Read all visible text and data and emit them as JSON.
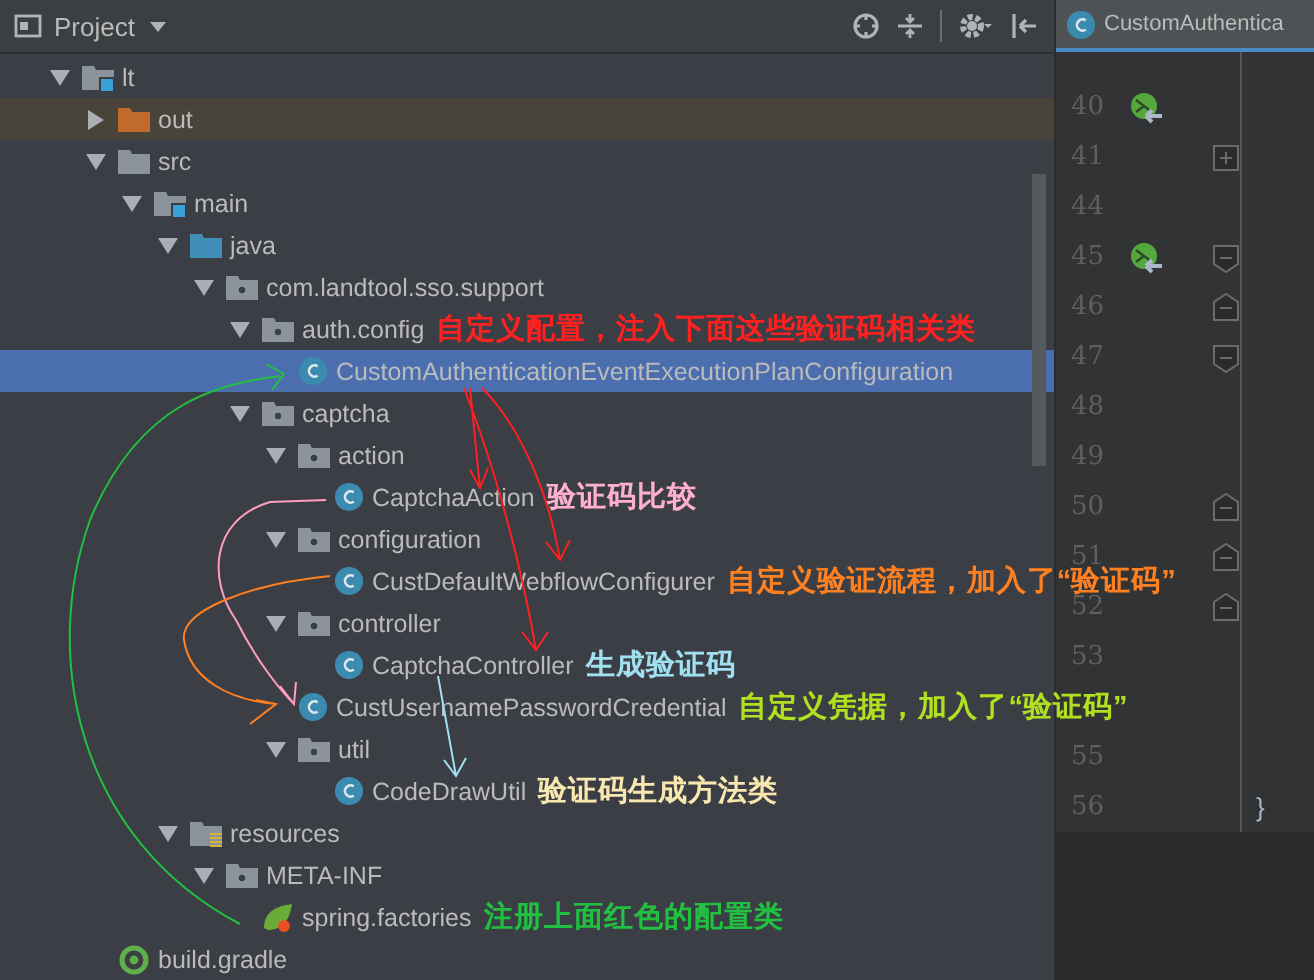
{
  "panel": {
    "title": "Project"
  },
  "tree": [
    {
      "label": "lt",
      "kind": "module",
      "expanded": true,
      "selected": false,
      "children": [
        {
          "label": "out",
          "kind": "excluded",
          "expanded": false,
          "selected": false
        },
        {
          "label": "src",
          "kind": "folder",
          "expanded": true,
          "selected": false,
          "children": [
            {
              "label": "main",
              "kind": "module",
              "expanded": true,
              "selected": false,
              "children": [
                {
                  "label": "java",
                  "kind": "source",
                  "expanded": true,
                  "selected": false,
                  "children": [
                    {
                      "label": "com.landtool.sso.support",
                      "kind": "package",
                      "expanded": true,
                      "selected": false,
                      "children": [
                        {
                          "label": "auth.config",
                          "kind": "package",
                          "expanded": true,
                          "selected": false,
                          "note": {
                            "text": "自定义配置，注入下面这些验证码相关类",
                            "color": "#ff2020"
                          },
                          "children": [
                            {
                              "label": "CustomAuthenticationEventExecutionPlanConfiguration",
                              "kind": "class",
                              "selected": true
                            }
                          ]
                        },
                        {
                          "label": "captcha",
                          "kind": "package",
                          "expanded": true,
                          "selected": false,
                          "children": [
                            {
                              "label": "action",
                              "kind": "package",
                              "expanded": true,
                              "selected": false,
                              "children": [
                                {
                                  "label": "CaptchaAction",
                                  "kind": "class",
                                  "selected": false,
                                  "note": {
                                    "text": "验证码比较",
                                    "color": "#ffb0d0"
                                  }
                                }
                              ]
                            },
                            {
                              "label": "configuration",
                              "kind": "package",
                              "expanded": true,
                              "selected": false,
                              "children": [
                                {
                                  "label": "CustDefaultWebflowConfigurer",
                                  "kind": "class",
                                  "selected": false,
                                  "note": {
                                    "text": "自定义验证流程，加入了“验证码”",
                                    "color": "#ff8020"
                                  }
                                }
                              ]
                            },
                            {
                              "label": "controller",
                              "kind": "package",
                              "expanded": true,
                              "selected": false,
                              "children": [
                                {
                                  "label": "CaptchaController",
                                  "kind": "class",
                                  "selected": false,
                                  "note": {
                                    "text": "生成验证码",
                                    "color": "#a0e0f0"
                                  }
                                }
                              ]
                            },
                            {
                              "label": "CustUsernamePasswordCredential",
                              "kind": "class",
                              "selected": false,
                              "note": {
                                "text": "自定义凭据，加入了“验证码”",
                                "color": "#b0e020"
                              }
                            },
                            {
                              "label": "util",
                              "kind": "package",
                              "expanded": true,
                              "selected": false,
                              "children": [
                                {
                                  "label": "CodeDrawUtil",
                                  "kind": "class",
                                  "selected": false,
                                  "note": {
                                    "text": "验证码生成方法类",
                                    "color": "#f8e8b0"
                                  }
                                }
                              ]
                            }
                          ]
                        }
                      ]
                    }
                  ]
                },
                {
                  "label": "resources",
                  "kind": "resources",
                  "expanded": true,
                  "selected": false,
                  "children": [
                    {
                      "label": "META-INF",
                      "kind": "package",
                      "expanded": true,
                      "selected": false,
                      "children": [
                        {
                          "label": "spring.factories",
                          "kind": "spring",
                          "selected": false,
                          "note": {
                            "text": "注册上面红色的配置类",
                            "color": "#20c040"
                          }
                        }
                      ]
                    }
                  ]
                }
              ]
            }
          ]
        },
        {
          "label": "build.gradle",
          "kind": "gradle",
          "selected": false
        }
      ]
    }
  ],
  "editor": {
    "tab": "CustomAuthentica",
    "lines": [
      {
        "kind": "numbered",
        "number": "40",
        "marker": {
          "kind": "override"
        }
      },
      {
        "kind": "numbered",
        "number": "41",
        "fold": {
          "kind": "plus"
        }
      },
      {
        "kind": "numbered",
        "number": "44"
      },
      {
        "kind": "numbered",
        "number": "45",
        "marker": {
          "kind": "override"
        },
        "fold": {
          "kind": "start"
        }
      },
      {
        "kind": "numbered",
        "number": "46",
        "fold": {
          "kind": "end"
        }
      },
      {
        "kind": "numbered",
        "number": "47",
        "fold": {
          "kind": "start"
        }
      },
      {
        "kind": "numbered",
        "number": "48"
      },
      {
        "kind": "numbered",
        "number": "49"
      },
      {
        "kind": "numbered",
        "number": "50",
        "fold": {
          "kind": "end"
        }
      },
      {
        "kind": "numbered",
        "number": "51",
        "fold": {
          "kind": "end"
        }
      },
      {
        "kind": "numbered",
        "number": "52",
        "fold": {
          "kind": "end"
        }
      },
      {
        "kind": "numbered",
        "number": "53"
      },
      {
        "kind": "covered"
      },
      {
        "kind": "numbered",
        "number": "55"
      },
      {
        "kind": "numbered",
        "number": "56",
        "code": "}"
      }
    ]
  }
}
